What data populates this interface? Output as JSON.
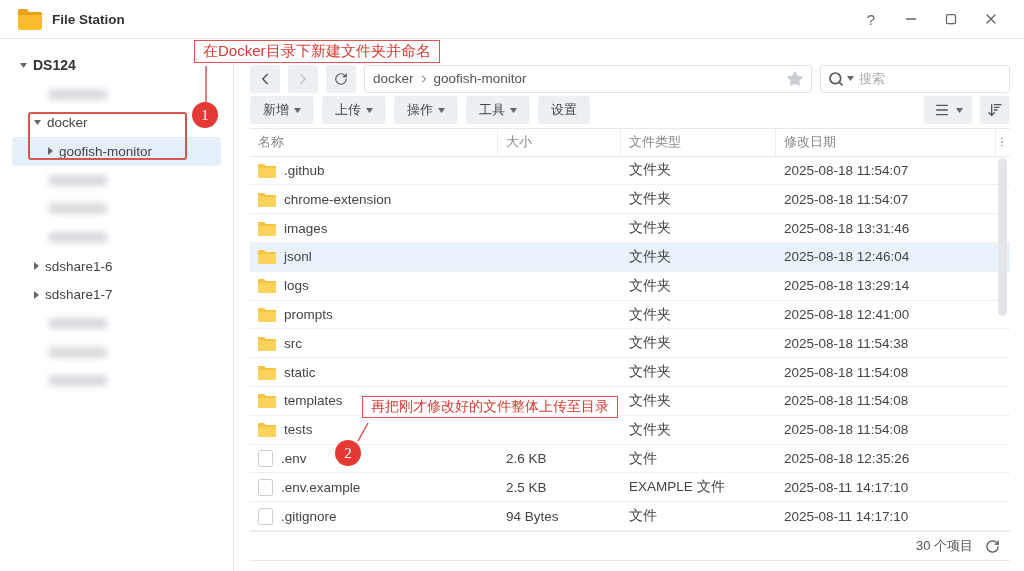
{
  "window": {
    "title": "File Station",
    "help": "?"
  },
  "sidebar": {
    "root": {
      "label": "DS124",
      "expanded": true,
      "children": [
        {
          "kind": "blurred"
        },
        {
          "kind": "folder",
          "label": "docker",
          "expanded": true,
          "selected": false,
          "children": [
            {
              "kind": "folder",
              "label": "goofish-monitor",
              "expanded": false,
              "selected": true
            }
          ]
        },
        {
          "kind": "blurred"
        },
        {
          "kind": "blurred"
        },
        {
          "kind": "blurred"
        },
        {
          "kind": "folder",
          "label": "sdshare1-6",
          "expanded": false,
          "selected": false
        },
        {
          "kind": "folder",
          "label": "sdshare1-7",
          "expanded": false,
          "selected": false
        },
        {
          "kind": "blurred"
        },
        {
          "kind": "blurred"
        },
        {
          "kind": "blurred"
        }
      ]
    }
  },
  "path": {
    "segments": [
      "docker",
      "goofish-monitor"
    ]
  },
  "search": {
    "placeholder": "搜索"
  },
  "toolbar": [
    {
      "label": "新增",
      "menu": true
    },
    {
      "label": "上传",
      "menu": true
    },
    {
      "label": "操作",
      "menu": true
    },
    {
      "label": "工具",
      "menu": true
    },
    {
      "label": "设置",
      "menu": false
    }
  ],
  "table": {
    "columns": [
      "名称",
      "大小",
      "文件类型",
      "修改日期"
    ],
    "rows": [
      {
        "kind": "folder",
        "name": ".github",
        "size": "",
        "type": "文件夹",
        "modified": "2025-08-18 11:54:07",
        "selected": false
      },
      {
        "kind": "folder",
        "name": "chrome-extension",
        "size": "",
        "type": "文件夹",
        "modified": "2025-08-18 11:54:07",
        "selected": false
      },
      {
        "kind": "folder",
        "name": "images",
        "size": "",
        "type": "文件夹",
        "modified": "2025-08-18 13:31:46",
        "selected": false
      },
      {
        "kind": "folder",
        "name": "jsonl",
        "size": "",
        "type": "文件夹",
        "modified": "2025-08-18 12:46:04",
        "selected": true
      },
      {
        "kind": "folder",
        "name": "logs",
        "size": "",
        "type": "文件夹",
        "modified": "2025-08-18 13:29:14",
        "selected": false
      },
      {
        "kind": "folder",
        "name": "prompts",
        "size": "",
        "type": "文件夹",
        "modified": "2025-08-18 12:41:00",
        "selected": false
      },
      {
        "kind": "folder",
        "name": "src",
        "size": "",
        "type": "文件夹",
        "modified": "2025-08-18 11:54:38",
        "selected": false
      },
      {
        "kind": "folder",
        "name": "static",
        "size": "",
        "type": "文件夹",
        "modified": "2025-08-18 11:54:08",
        "selected": false
      },
      {
        "kind": "folder",
        "name": "templates",
        "size": "",
        "type": "文件夹",
        "modified": "2025-08-18 11:54:08",
        "selected": false
      },
      {
        "kind": "folder",
        "name": "tests",
        "size": "",
        "type": "文件夹",
        "modified": "2025-08-18 11:54:08",
        "selected": false
      },
      {
        "kind": "file",
        "name": ".env",
        "size": "2.6 KB",
        "type": "文件",
        "modified": "2025-08-18 12:35:26",
        "selected": false
      },
      {
        "kind": "file",
        "name": ".env.example",
        "size": "2.5 KB",
        "type": "EXAMPLE 文件",
        "modified": "2025-08-11 14:17:10",
        "selected": false
      },
      {
        "kind": "file",
        "name": ".gitignore",
        "size": "94 Bytes",
        "type": "文件",
        "modified": "2025-08-11 14:17:10",
        "selected": false
      }
    ]
  },
  "status_bar": {
    "count": "30 个项目"
  },
  "annotations": [
    {
      "number": "1",
      "text": "在Docker目录下新建文件夹并命名"
    },
    {
      "number": "2",
      "text": "再把刚才修改好的文件整体上传至目录"
    }
  ]
}
